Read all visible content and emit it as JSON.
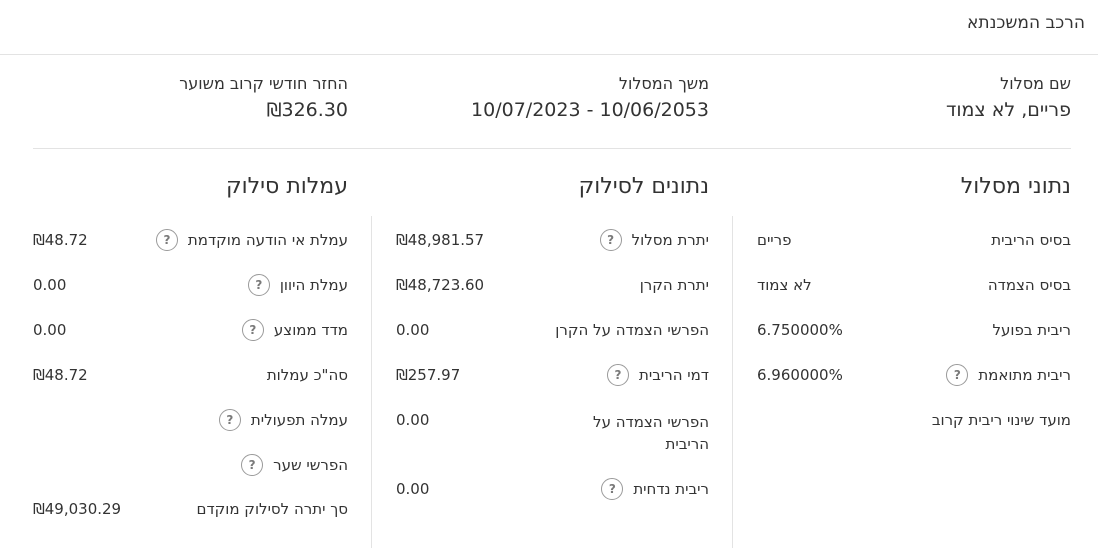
{
  "header": {
    "title": "הרכב המשכנתא"
  },
  "summary": {
    "track_name_label": "שם מסלול",
    "track_name_value": "פריים, לא צמוד",
    "duration_label": "משך המסלול",
    "duration_value": "10/07/2023 - 10/06/2053",
    "monthly_label": "החזר חודשי קרוב משוער",
    "monthly_value": "₪326.30"
  },
  "track_data": {
    "title": "נתוני מסלול",
    "rows": [
      {
        "label": "בסיס הריבית",
        "value": "פריים",
        "help": false
      },
      {
        "label": "בסיס הצמדה",
        "value": "לא צמוד",
        "help": false
      },
      {
        "label": "ריבית בפועל",
        "value": "6.750000%",
        "help": false
      },
      {
        "label": "ריבית מתואמת",
        "value": "6.960000%",
        "help": true
      },
      {
        "label": "מועד שינוי ריבית קרוב",
        "value": "",
        "help": false
      }
    ]
  },
  "payoff_data": {
    "title": "נתונים לסילוק",
    "rows": [
      {
        "label": "יתרת מסלול",
        "value": "₪48,981.57",
        "help": true
      },
      {
        "label": "יתרת הקרן",
        "value": "₪48,723.60",
        "help": false
      },
      {
        "label": "הפרשי הצמדה על הקרן",
        "value": "0.00",
        "help": false
      },
      {
        "label": "דמי הריבית",
        "value": "₪257.97",
        "help": true
      },
      {
        "label": "הפרשי הצמדה על הריבית",
        "value": "0.00",
        "help": false
      },
      {
        "label": "ריבית נדחית",
        "value": "0.00",
        "help": true
      }
    ]
  },
  "fees": {
    "title": "עמלות סילוק",
    "rows": [
      {
        "label": "עמלת אי הודעה מוקדמת",
        "value": "₪48.72",
        "help": true
      },
      {
        "label": "עמלת היוון",
        "value": "0.00",
        "help": true
      },
      {
        "label": "מדד ממוצע",
        "value": "0.00",
        "help": true
      },
      {
        "label": "סה\"כ עמלות",
        "value": "₪48.72",
        "help": false
      },
      {
        "label": "עמלה תפעולית",
        "value": "",
        "help": true
      },
      {
        "label": "הפרשי שער",
        "value": "",
        "help": true
      },
      {
        "label": "סך יתרה לסילוק מוקדם",
        "value": "₪49,030.29",
        "help": false
      }
    ]
  },
  "icons": {
    "help": "question-circle-icon"
  }
}
